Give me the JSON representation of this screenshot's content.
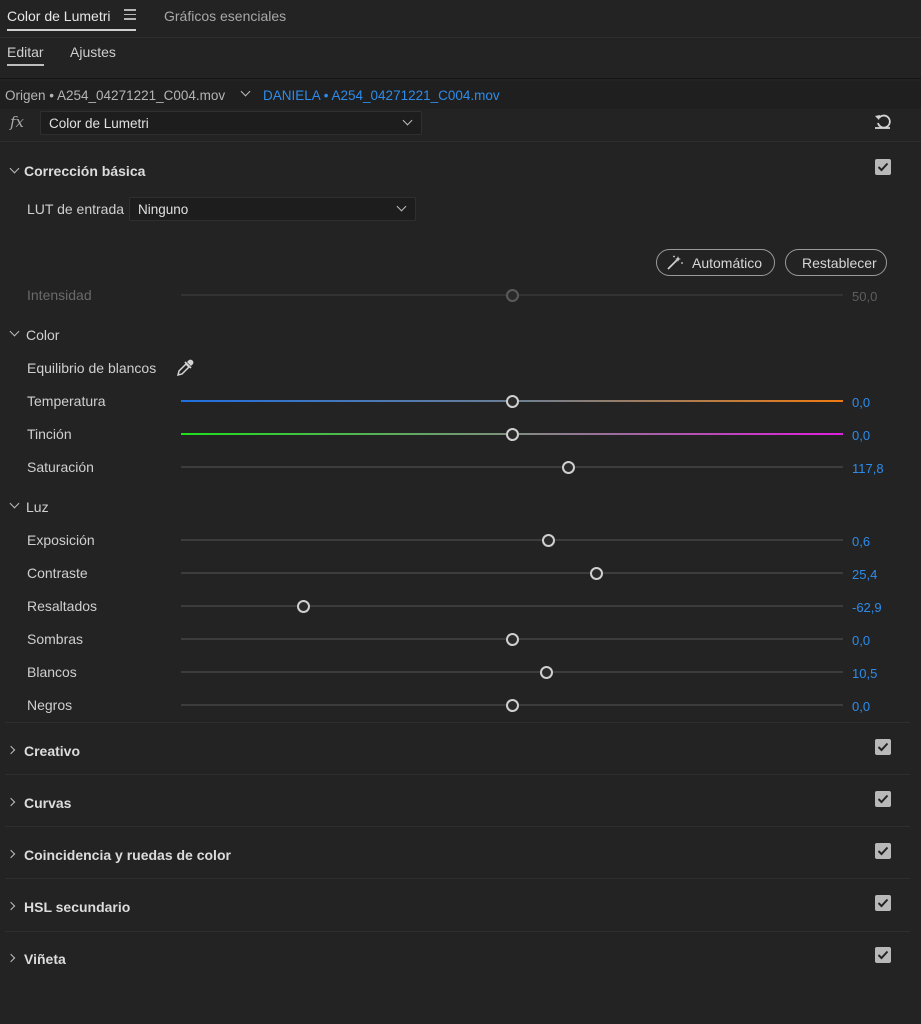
{
  "panel_tabs": {
    "active": "Color de Lumetri",
    "other": "Gráficos esenciales"
  },
  "sub_tabs": {
    "edit": "Editar",
    "presets": "Ajustes"
  },
  "source": {
    "origin": "Origen • A254_04271221_C004.mov",
    "sequence": "DANIELA • A254_04271221_C004.mov"
  },
  "fx": {
    "label": "fx",
    "effect": "Color de Lumetri"
  },
  "basic": {
    "title": "Corrección básica",
    "lut_label": "LUT de entrada",
    "lut_value": "Ninguno",
    "auto_button": "Automático",
    "reset_button": "Restablecer",
    "intensity_label": "Intensidad",
    "intensity_value": "50,0",
    "intensity_fraction": 0.5,
    "color_header": "Color",
    "white_balance_label": "Equilibrio de blancos",
    "color_rows": [
      {
        "label": "Temperatura",
        "value": "0,0",
        "fraction": 0.5
      },
      {
        "label": "Tinción",
        "value": "0,0",
        "fraction": 0.5
      },
      {
        "label": "Saturación",
        "value": "117,8",
        "fraction": 0.585
      }
    ],
    "light_header": "Luz",
    "light_rows": [
      {
        "label": "Exposición",
        "value": "0,6",
        "fraction": 0.555
      },
      {
        "label": "Contraste",
        "value": "25,4",
        "fraction": 0.627
      },
      {
        "label": "Resaltados",
        "value": "-62,9",
        "fraction": 0.185
      },
      {
        "label": "Sombras",
        "value": "0,0",
        "fraction": 0.5
      },
      {
        "label": "Blancos",
        "value": "10,5",
        "fraction": 0.552
      },
      {
        "label": "Negros",
        "value": "0,0",
        "fraction": 0.5
      }
    ]
  },
  "sections": [
    {
      "title": "Creativo"
    },
    {
      "title": "Curvas"
    },
    {
      "title": "Coincidencia y ruedas de color"
    },
    {
      "title": "HSL secundario"
    },
    {
      "title": "Viñeta"
    }
  ],
  "colors": {
    "accent": "#2d8ceb",
    "temperature_left": "#1f6fe0",
    "temperature_right": "#f07a10",
    "tint_left": "#1ee01e",
    "tint_right": "#e01ee0"
  }
}
